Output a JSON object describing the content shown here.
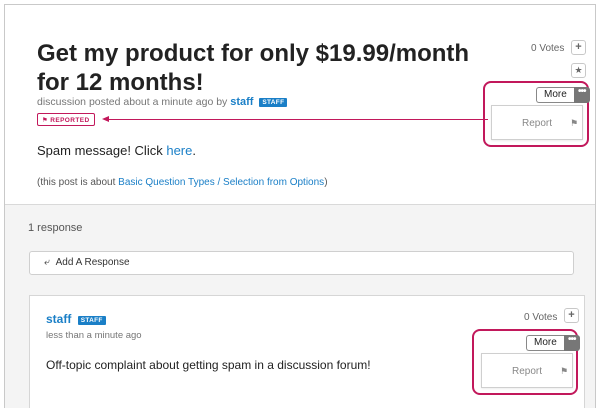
{
  "colors": {
    "accent": "#1a7fc7",
    "highlight": "#c2185b",
    "muted": "#767676"
  },
  "post": {
    "title": "Get my product for only $19.99/month for 12 months!",
    "meta_prefix": "discussion posted about a minute ago by",
    "author": "staff",
    "author_badge": "STAFF",
    "reported_label": "REPORTED",
    "body_prefix": "Spam message! Click",
    "body_link": "here",
    "body_suffix": ".",
    "about_prefix": "(this post is about",
    "about_link": "Basic Question Types / Selection from Options",
    "about_suffix": ")",
    "votes": "0 Votes",
    "vote_up_icon": "plus-icon",
    "follow_icon": "star-icon",
    "more_label": "More",
    "more_icon": "ellipsis-icon",
    "report_label": "Report",
    "report_icon": "flag-icon"
  },
  "responses": {
    "count_label": "1 response",
    "add_response_label": "Add A Response",
    "add_response_icon": "reply-icon",
    "items": [
      {
        "author": "staff",
        "author_badge": "STAFF",
        "time": "less than a minute ago",
        "body": "Off-topic complaint about getting spam in a discussion forum!",
        "votes": "0 Votes",
        "more_label": "More",
        "report_label": "Report"
      }
    ]
  }
}
